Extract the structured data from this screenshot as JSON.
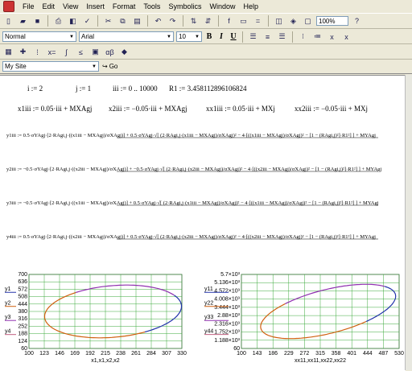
{
  "menu": [
    "File",
    "Edit",
    "View",
    "Insert",
    "Format",
    "Tools",
    "Symbolics",
    "Window",
    "Help"
  ],
  "toolbar": {
    "zoom": "100%"
  },
  "format_bar": {
    "style": "Normal",
    "font": "Arial",
    "size": "10",
    "bold": "B",
    "italic": "I",
    "underline": "U"
  },
  "resource": {
    "site": "My Site",
    "go": "Go"
  },
  "defs": {
    "i": "i := 2",
    "j": "j := 1",
    "iii": "iii := 0 .. 10000",
    "R1": "R1 := 3.458112896106824"
  },
  "xdefs": {
    "x1": "x1iii := 0.05·iii + MXAgj",
    "x2": "x2iii := −0.05·iii + MXAgj",
    "xx1": "xx1iii := 0.05·iii + MXj",
    "xx2": "xx2iii := −0.05·iii + MXj"
  },
  "equations": {
    "y1": "y1iii := 0.5·σYAgj·[2·RAgi,j·((x1iii − MXAgj)/σXAgj)] + 0.5·σYAgj·√[ (2·RAgi,j·(x1iii − MXAgj)/σXAgj)² − 4·[((x1iii − MXAgj)/σXAgj)² − [1 − (RAgi,j)²]·R1²] ] + MYAgj",
    "y2": "y2iii := −0.5·σYAgj·[2·RAgi,j·((x2iii − MXAgj)/σXAgj)] + −0.5·σYAgj·√[ (2·RAgi,j·(x2iii − MXAgj)/σXAgj)² − 4·[((x2iii − MXAgj)/σXAgj)² − [1 − (RAgi,j)²]·R1²] ] + MYAgj",
    "y3": "y3iii := −0.5·σYAgj·[2·RAgi,j·((x1iii − MXAgj)/σXAgj)] + 0.5·σYAgj·√[ (2·RAgi,j·(x1iii − MXAgj)/σXAgj)² − 4·[((x1iii − MXAgj)/σXAgj)² − [1 − (RAgi,j)²]·R1²] ] + MYAgj",
    "y4": "y4iii := 0.5·σYAgj·[2·RAgi,j·((x2iii − MXAgj)/σXAgj)] + 0.5·σYAgj·√[ (2·RAgi,j·(x2iii − MXAgj)/σXAgj)² − 4·[((x2iii − MXAgj)/σXAgj)² − [1 − (RAgi,j)²]·R1²] ] + MYAgj"
  },
  "plot1": {
    "yticks": [
      "60",
      "124",
      "188",
      "252",
      "316",
      "380",
      "444",
      "508",
      "572",
      "636",
      "700"
    ],
    "xticks": [
      "100",
      "123",
      "146",
      "169",
      "192",
      "215",
      "238",
      "261",
      "284",
      "307",
      "330"
    ],
    "legend": [
      "y1",
      "y2",
      "y3",
      "y4"
    ],
    "xlabel": "x1,x1,x2,x2",
    "colors": [
      "#2233aa",
      "#d06010",
      "#9030b0",
      "#c06080"
    ]
  },
  "plot2": {
    "yticks": [
      "60",
      "1.188×10³",
      "1.752×10³",
      "2.316×10³",
      "2.88×10³",
      "3.444×10³",
      "4.008×10³",
      "4.572×10³",
      "5.136×10³",
      "5.7×10³"
    ],
    "xticks": [
      "100",
      "143",
      "186",
      "229",
      "272",
      "315",
      "358",
      "401",
      "444",
      "487",
      "530"
    ],
    "legend": [
      "y11",
      "y22",
      "y33",
      "y44"
    ],
    "xlabel": "xx11,xx11,xx22,xx22",
    "colors": [
      "#2233aa",
      "#d06010",
      "#9030b0",
      "#c06080"
    ]
  }
}
